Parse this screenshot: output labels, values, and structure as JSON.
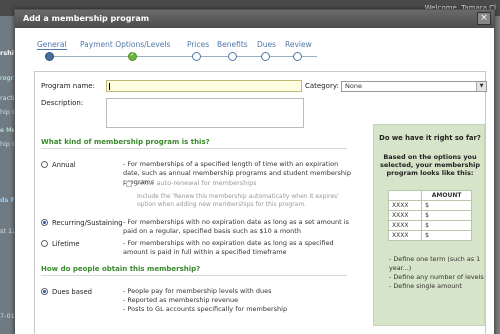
{
  "background": {
    "welcome_text": "Welcome, Tamara Cl",
    "left_fragments": [
      "rshi",
      "rogra",
      "ractive",
      "hip C",
      "e Me",
      "hip C",
      "ds for",
      "st 12 m",
      "7-01-21"
    ]
  },
  "dialog": {
    "title": "Add a membership program",
    "close_label": "×"
  },
  "wizard": {
    "steps": [
      "General",
      "Payment Options/Levels",
      "Prices",
      "Benefits",
      "Dues",
      "Review"
    ]
  },
  "form": {
    "program_name_label": "Program name:",
    "program_name_value": "",
    "category_label": "Category:",
    "category_value": "None",
    "description_label": "Description:"
  },
  "kind_section": {
    "title": "What kind of membership program is this?",
    "options": [
      {
        "label": "Annual",
        "checked": false,
        "desc": "- For memberships of a specified length of time with an expiration date, such as annual membership programs and student membership programs"
      },
      {
        "label": "Recurring/Sustaining",
        "checked": true,
        "desc": "- For memberships with no expiration date as long as a set amount is paid on a regular, specified basis such as $10 a month"
      },
      {
        "label": "Lifetime",
        "checked": false,
        "desc": "- For memberships with no expiration date as long as a specified amount is paid in full within a specified timeframe"
      }
    ],
    "auto_renewal_label": "Allow auto-renewal for memberships",
    "auto_renewal_note": "Include the 'Renew this membership automatically when it expires' option when adding new memberships for this program."
  },
  "dues_section": {
    "title": "How do people obtain this membership?",
    "option_label": "Dues based",
    "bullets": [
      "- People pay for membership levels with dues",
      "- Reported as membership revenue",
      "- Posts to GL accounts specifically for membership"
    ]
  },
  "summary": {
    "title": "Do we have it right so far?",
    "subtitle": "Based on the options you selected, your membership program looks like this:",
    "amount_header": "AMOUNT",
    "rows": [
      {
        "name": "XXXX",
        "amount": "$"
      },
      {
        "name": "XXXX",
        "amount": "$"
      },
      {
        "name": "XXXX",
        "amount": "$"
      },
      {
        "name": "XXXX",
        "amount": "$"
      }
    ],
    "bullets": [
      "- Define one term (such as 1 year...)",
      "- Define any number of levels",
      "- Define single amount"
    ]
  }
}
